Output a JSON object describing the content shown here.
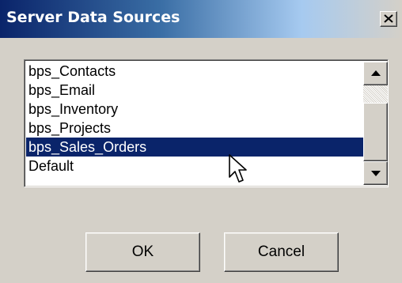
{
  "dialog": {
    "title": "Server Data Sources",
    "close_icon": "close-icon"
  },
  "list": {
    "items": [
      {
        "label": "bps_Contacts",
        "selected": false
      },
      {
        "label": "bps_Email",
        "selected": false
      },
      {
        "label": "bps_Inventory",
        "selected": false
      },
      {
        "label": "bps_Projects",
        "selected": false
      },
      {
        "label": "bps_Sales_Orders",
        "selected": true
      },
      {
        "label": "Default",
        "selected": false
      }
    ],
    "selection_color": "#0a246a"
  },
  "scrollbar": {
    "up_icon": "arrow-up-icon",
    "down_icon": "arrow-down-icon"
  },
  "buttons": {
    "ok_label": "OK",
    "cancel_label": "Cancel"
  },
  "cursor_icon": "mouse-pointer-icon"
}
